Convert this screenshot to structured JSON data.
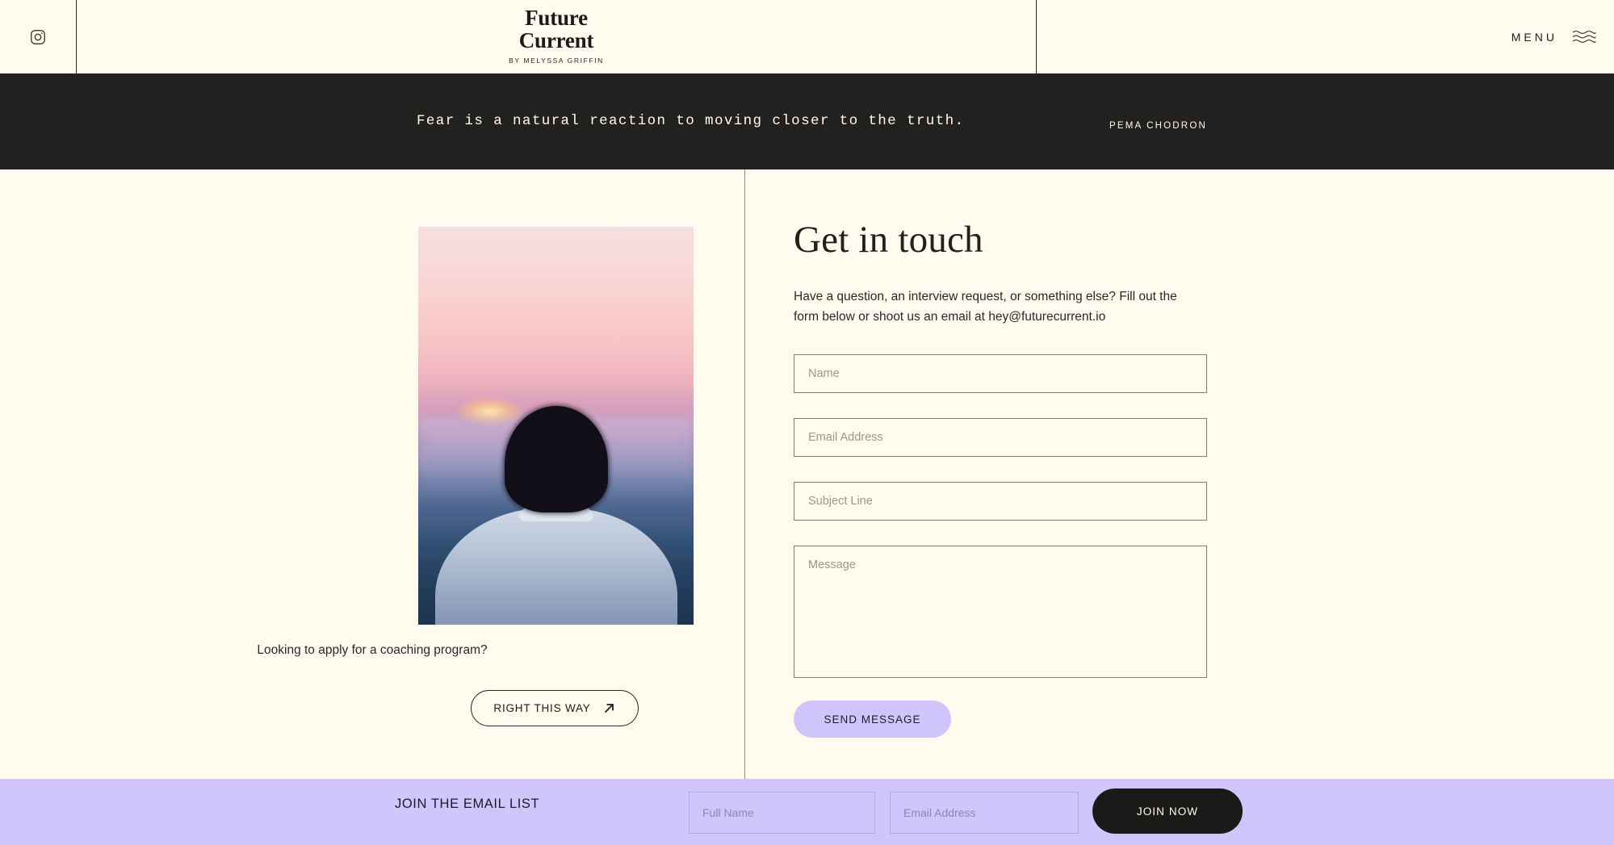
{
  "header": {
    "social_icon": "instagram-icon",
    "logo_line1": "Future",
    "logo_line2": "Current",
    "logo_subtitle": "BY MELYSSA GRIFFIN",
    "menu_label": "MENU",
    "menu_icon": "wavy-lines-menu-icon"
  },
  "quote_bar": {
    "quote": "Fear is a natural reaction to moving closer to the truth.",
    "author": "PEMA CHODRON",
    "background_color": "#232020",
    "text_color": "#FFFCEF"
  },
  "left_column": {
    "photo_alt": "woman from behind watching sunset over city",
    "caption": "Looking to apply for a coaching program?",
    "cta_label": "RIGHT THIS WAY",
    "cta_icon": "arrow-up-right-icon"
  },
  "contact": {
    "heading": "Get in touch",
    "intro": "Have a question, an interview request, or something else? Fill out the form below or shoot us an email at hey@futurecurrent.io",
    "email": "hey@futurecurrent.io",
    "fields": {
      "name_placeholder": "Name",
      "name_value": "",
      "email_placeholder": "Email Address",
      "email_value": "",
      "subject_placeholder": "Subject Line",
      "subject_value": "",
      "message_placeholder": "Message",
      "message_value": ""
    },
    "submit_label": "SEND MESSAGE",
    "submit_color": "#CFC5FB"
  },
  "footer": {
    "label": "JOIN THE EMAIL LIST",
    "name_placeholder": "Full Name",
    "name_value": "",
    "email_placeholder": "Email Address",
    "email_value": "",
    "join_label": "JOIN NOW",
    "background_color": "#D0C6FB",
    "button_color": "#1b1a18"
  },
  "theme": {
    "page_background": "#FFFCEF",
    "ink": "#1d1b18",
    "accent": "#CFC5FB"
  }
}
